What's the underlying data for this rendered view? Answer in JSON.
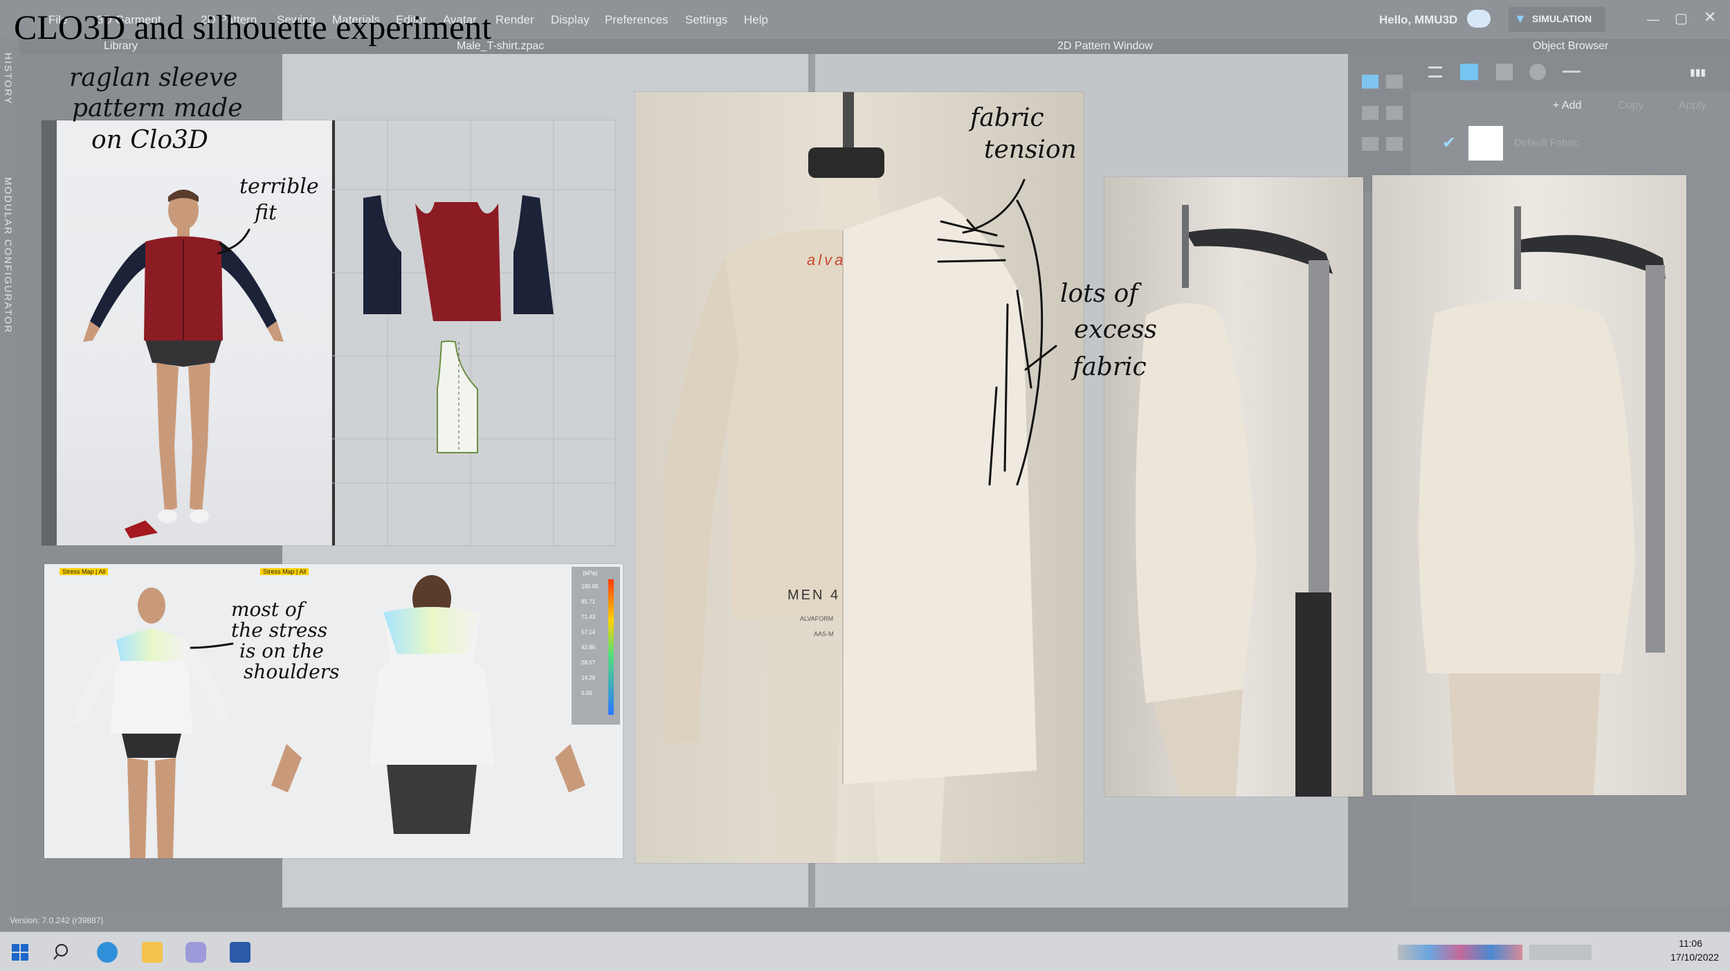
{
  "overlay_title": "CLO3D and silhouette experiment",
  "menubar": {
    "items": [
      "File",
      "3D Garment",
      "2D Pattern",
      "Sewing",
      "Materials",
      "Editor",
      "Avatar",
      "Render",
      "Display",
      "Preferences",
      "Settings",
      "Help"
    ],
    "greeting": "Hello, MMU3D",
    "mode_label": "SIMULATION"
  },
  "panels": {
    "library": "Library",
    "file_tab": "Male_T-shirt.zpac",
    "pattern_window": "2D Pattern Window",
    "object_browser": "Object Browser",
    "history": "HISTORY",
    "modular": "MODULAR CONFIGURATOR",
    "add_label": "+ Add",
    "copy_label": "Copy",
    "apply_label": "Apply",
    "default_fabric": "Default Fabric"
  },
  "status": {
    "version": "Version: 7.0.242 (r39887)"
  },
  "taskbar": {
    "time": "11:06",
    "date": "17/10/2022"
  },
  "annotations": {
    "raglan": [
      "raglan sleeve",
      "pattern made",
      "on Clo3D"
    ],
    "terrible_fit": [
      "terrible",
      "fit"
    ],
    "stress": [
      "most of",
      "the stress",
      "is on the",
      "shoulders"
    ],
    "fabric_tension": [
      "fabric",
      "tension"
    ],
    "excess": [
      "lots of",
      "excess",
      "fabric"
    ]
  },
  "stress_map": {
    "header": "Stress Map | All"
  },
  "stress_legend": {
    "unit": "(kPa)",
    "values": [
      "100.00",
      "85.71",
      "71.43",
      "57.14",
      "42.86",
      "28.57",
      "14.29",
      "0.00"
    ]
  },
  "form_labels": {
    "brand": "alva",
    "size": "MEN 4",
    "line1": "ALVAFORM",
    "line2": "AAS-M"
  },
  "colors": {
    "sleeve_navy": "#1c2238",
    "body_red": "#8c1c24",
    "muslin": "#e3d8c6",
    "pattern_white": "#f2f5ee"
  }
}
